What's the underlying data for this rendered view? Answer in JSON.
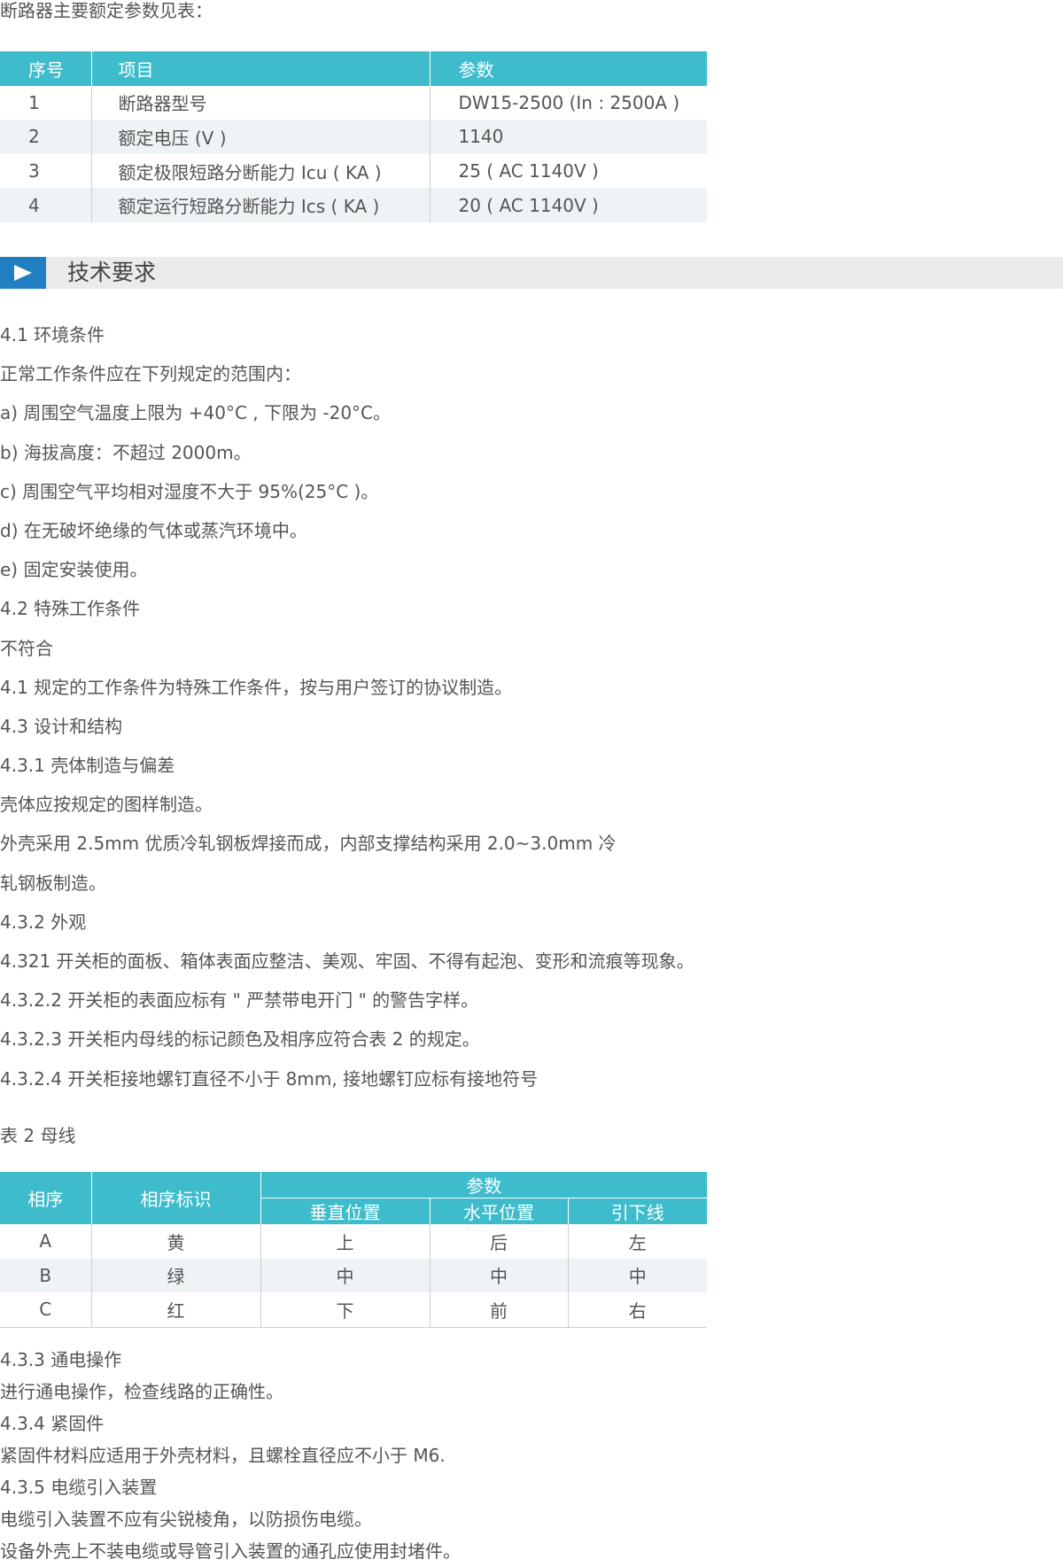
{
  "intro": "断路器主要额定参数见表：",
  "table1": {
    "headers": [
      "序号",
      "项目",
      "参数"
    ],
    "rows": [
      [
        "1",
        "断路器型号",
        "DW15-2500 (In : 2500A )"
      ],
      [
        "2",
        "额定电压 (V )",
        "1140"
      ],
      [
        "3",
        "额定极限短路分断能力 Icu ( KA )",
        "25 ( AC 1140V )"
      ],
      [
        "4",
        "额定运行短路分断能力 Ics ( KA )",
        "20 ( AC 1140V )"
      ]
    ]
  },
  "section": {
    "title": "技术要求",
    "icon": "play-triangle-icon",
    "accent_color": "#1f7fc0",
    "bar_color": "#ebebeb"
  },
  "paragraphs": [
    "4.1 环境条件",
    "正常工作条件应在下列规定的范围内：",
    "a) 周围空气温度上限为 +40°C , 下限为 -20°C。",
    "b) 海拔高度：不超过 2000m。",
    "c) 周围空气平均相对湿度不大于 95%(25°C )。",
    "d) 在无破坏绝缘的气体或蒸汽环境中。",
    "e) 固定安装使用。",
    "4.2 特殊工作条件",
    "不符合",
    "4.1 规定的工作条件为特殊工作条件，按与用户签订的协议制造。",
    "4.3 设计和结构",
    "4.3.1 壳体制造与偏差",
    "壳体应按规定的图样制造。",
    "外壳采用 2.5mm 优质冷轧钢板焊接而成，内部支撑结构采用 2.0~3.0mm 冷",
    "轧钢板制造。",
    "4.3.2 外观",
    "4.321 开关柜的面板、箱体表面应整洁、美观、牢固、不得有起泡、变形和流痕等现象。",
    "4.3.2.2 开关柜的表面应标有 \" 严禁带电开门 \" 的警告字样。",
    "4.3.2.3 开关柜内母线的标记颜色及相序应符合表 2 的规定。",
    "4.3.2.4 开关柜接地螺钉直径不小于 8mm, 接地螺钉应标有接地符号"
  ],
  "table2": {
    "caption": "表 2 母线",
    "header_phase": "相序",
    "header_mark": "相序标识",
    "header_params": "参数",
    "sub_headers": [
      "垂直位置",
      "水平位置",
      "引下线"
    ],
    "rows": [
      [
        "A",
        "黄",
        "上",
        "后",
        "左"
      ],
      [
        "B",
        "绿",
        "中",
        "中",
        "中"
      ],
      [
        "C",
        "红",
        "下",
        "前",
        "右"
      ]
    ],
    "header_color": "#3ebccc",
    "stripe_color": "#eef3f5"
  },
  "paragraphs2": [
    "4.3.3 通电操作",
    "进行通电操作，检查线路的正确性。",
    "4.3.4 紧固件",
    "紧固件材料应适用于外壳材料，且螺栓直径应不小于 M6.",
    "4.3.5 电缆引入装置",
    "电缆引入装置不应有尖锐棱角，以防损伤电缆。",
    "设备外壳上不装电缆或导管引入装置的通孔应使用封堵件。"
  ]
}
